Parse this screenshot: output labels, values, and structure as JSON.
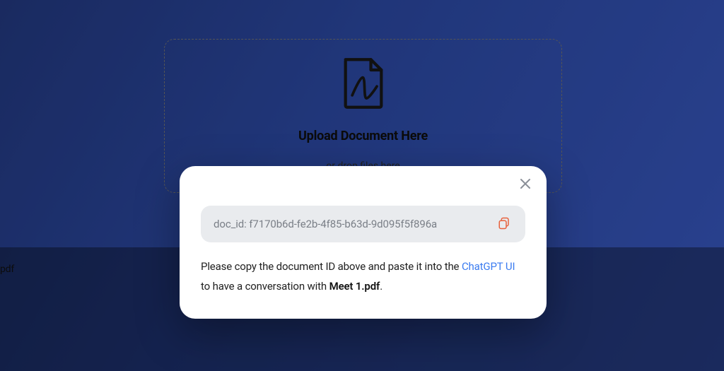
{
  "dropzone": {
    "title": "Upload Document Here",
    "subtitle": "or drop files here"
  },
  "bottom": {
    "stub": "pdf"
  },
  "modal": {
    "doc_id_label": "doc_id: f7170b6d-fe2b-4f85-b63d-9d095f5f896a",
    "instruction_prefix": "Please copy the document ID above and paste it into the ",
    "link_text": "ChatGPT UI",
    "instruction_middle": " to have a conversation with ",
    "filename": "Meet 1.pdf",
    "instruction_suffix": "."
  }
}
